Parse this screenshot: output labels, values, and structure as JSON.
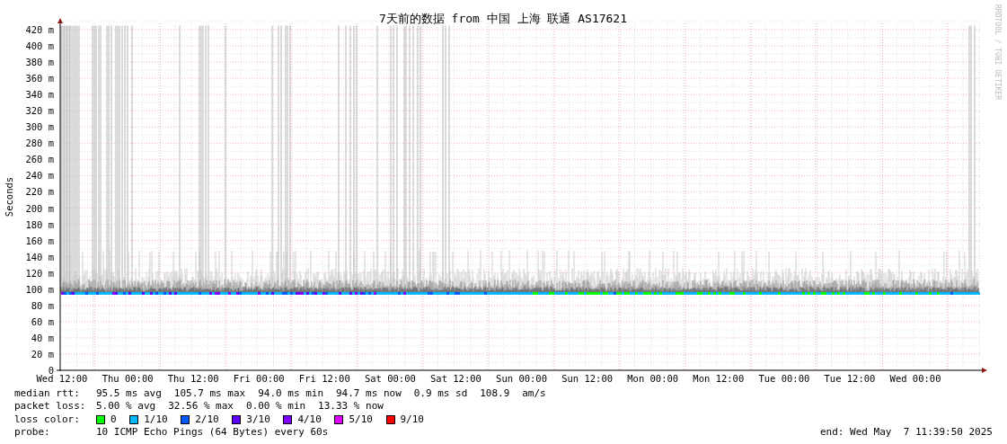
{
  "title": "7天前的数据 from 中国 上海 联通 AS17621",
  "credit": "RRDTOOL / TOBI OETIKER",
  "y_axis": {
    "label": "Seconds",
    "ticks": [
      "420 m",
      "400 m",
      "380 m",
      "360 m",
      "340 m",
      "320 m",
      "300 m",
      "280 m",
      "260 m",
      "240 m",
      "220 m",
      "200 m",
      "180 m",
      "160 m",
      "140 m",
      "120 m",
      "100 m",
      "80 m",
      "60 m",
      "40 m",
      "20 m",
      "0"
    ]
  },
  "x_axis": {
    "ticks": [
      "Wed 12:00",
      "Thu 00:00",
      "Thu 12:00",
      "Fri 00:00",
      "Fri 12:00",
      "Sat 00:00",
      "Sat 12:00",
      "Sun 00:00",
      "Sun 12:00",
      "Mon 00:00",
      "Mon 12:00",
      "Tue 00:00",
      "Tue 12:00",
      "Wed 00:00"
    ]
  },
  "median_rtt": {
    "label": "median rtt:",
    "values": [
      "95.5 ms avg",
      "105.7 ms max",
      "94.0 ms min",
      "94.7 ms now",
      "0.9 ms sd",
      "108.9",
      "am/s"
    ]
  },
  "packet_loss": {
    "label": "packet loss:",
    "values": [
      "5.00 % avg",
      "32.56 % max",
      "0.00 % min",
      "13.33 % now"
    ]
  },
  "loss_color": {
    "label": "loss color:",
    "items": [
      {
        "label": "0",
        "color": "#00ff00"
      },
      {
        "label": "1/10",
        "color": "#00b8ff"
      },
      {
        "label": "2/10",
        "color": "#0059ff"
      },
      {
        "label": "3/10",
        "color": "#5e00ff"
      },
      {
        "label": "4/10",
        "color": "#7e00ff"
      },
      {
        "label": "5/10",
        "color": "#dd00ff"
      },
      {
        "label": "9/10",
        "color": "#ff0000"
      }
    ]
  },
  "probe": {
    "label": "probe:",
    "text": "10 ICMP Echo Pings (64 Bytes) every 60s"
  },
  "end": "end: Wed May  7 11:39:50 2025"
}
